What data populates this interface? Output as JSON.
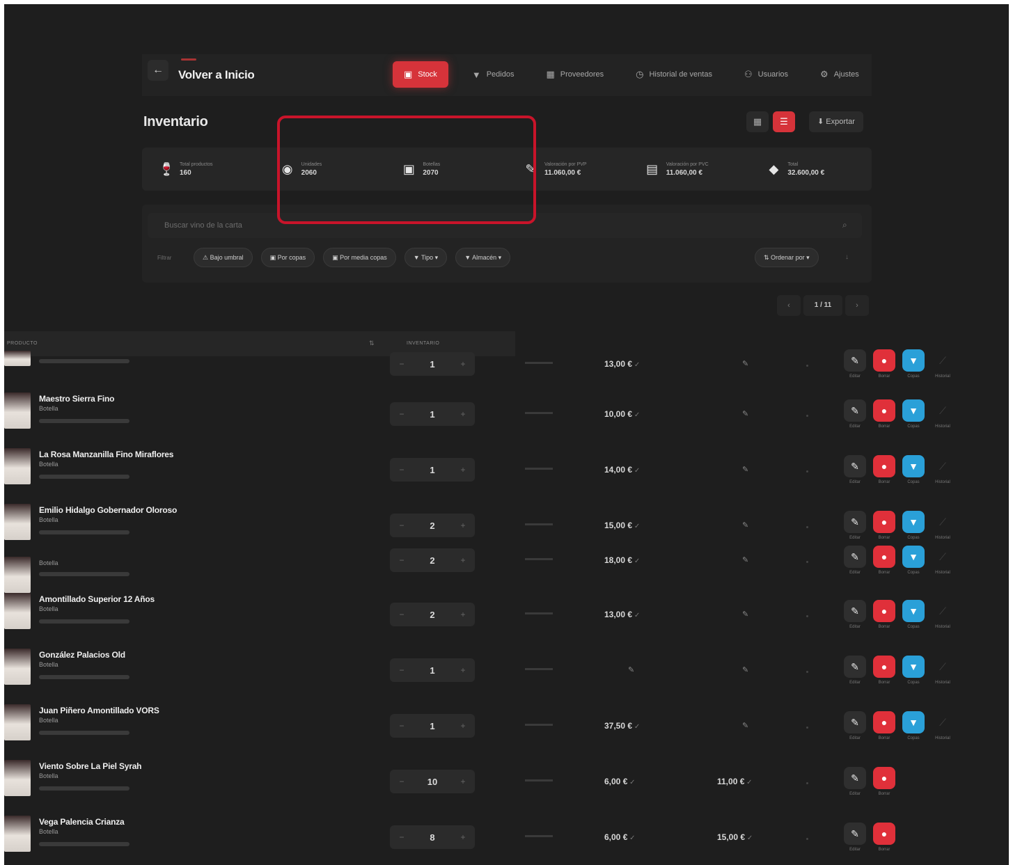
{
  "header": {
    "back_icon": "arrow-left-icon",
    "back_label": "Volver a Inicio"
  },
  "nav": [
    {
      "label": "Stock",
      "icon": "box-icon",
      "active": true
    },
    {
      "label": "Pedidos",
      "icon": "glass-icon"
    },
    {
      "label": "Proveedores",
      "icon": "building-icon"
    },
    {
      "label": "Historial de ventas",
      "icon": "clock-icon"
    },
    {
      "label": "Usuarios",
      "icon": "user-icon"
    },
    {
      "label": "Ajustes",
      "icon": "gear-icon"
    }
  ],
  "page": {
    "title": "Inventario",
    "export_label": "Exportar"
  },
  "stats": [
    {
      "label": "Total productos",
      "value": "160",
      "icon": "wine-glass-icon"
    },
    {
      "label": "Unidades",
      "value": "2060",
      "icon": "wine-bottle-icon"
    },
    {
      "label": "Botellas",
      "value": "2070",
      "icon": "calendar-icon"
    },
    {
      "label": "Valoración por PVP",
      "value": "11.060,00 €",
      "icon": "tag-icon"
    },
    {
      "label": "Valoración por PVC",
      "value": "11.060,00 €",
      "icon": "archive-icon"
    },
    {
      "label": "Total",
      "value": "32.600,00 €",
      "icon": "price-tag-icon"
    }
  ],
  "search": {
    "placeholder": "Buscar vino de la carta"
  },
  "filters": {
    "label": "Filtrar",
    "chips": [
      "Bajo umbral",
      "Por copas",
      "Por media copas",
      "Tipo",
      "Almacén"
    ],
    "sort_label": "Ordenar por"
  },
  "pagination": {
    "prev": "‹",
    "info": "1 / 11",
    "next": "›"
  },
  "table": {
    "col_product": "PRODUCTO",
    "col_stock": "INVENTARIO"
  },
  "rows": [
    {
      "name": "",
      "meta": "",
      "qty": "1",
      "price1": "13,00 €",
      "price2": "",
      "full_actions": true
    },
    {
      "name": "Maestro Sierra Fino",
      "meta": "Botella",
      "qty": "1",
      "price1": "10,00 €",
      "price2": "",
      "full_actions": true
    },
    {
      "name": "La Rosa Manzanilla Fino Miraflores",
      "meta": "Botella",
      "qty": "1",
      "price1": "14,00 €",
      "price2": "",
      "full_actions": true
    },
    {
      "name": "Emilio Hidalgo Gobernador Oloroso",
      "meta": "Botella",
      "qty": "2",
      "price1": "15,00 €",
      "price2": "",
      "full_actions": true
    },
    {
      "name": "",
      "meta": "Botella",
      "qty": "2",
      "price1": "18,00 €",
      "price2": "",
      "full_actions": true
    },
    {
      "name": "Amontillado Superior 12 Años",
      "meta": "Botella",
      "qty": "2",
      "price1": "13,00 €",
      "price2": "",
      "full_actions": true
    },
    {
      "name": "González Palacios Old",
      "meta": "Botella",
      "qty": "1",
      "price1": "",
      "price2": "",
      "full_actions": true
    },
    {
      "name": "Juan Piñero Amontillado VORS",
      "meta": "Botella",
      "qty": "1",
      "price1": "37,50 €",
      "price2": "",
      "full_actions": true
    },
    {
      "name": "Viento Sobre La Piel Syrah",
      "meta": "Botella",
      "qty": "10",
      "price1": "6,00 €",
      "price2": "11,00 €",
      "full_actions": false
    },
    {
      "name": "Vega Palencia Crianza",
      "meta": "Botella",
      "qty": "8",
      "price1": "6,00 €",
      "price2": "15,00 €",
      "full_actions": false
    }
  ],
  "actions": {
    "edit": "Editar",
    "delete": "Borrar",
    "info": "Copas",
    "more": "Historial"
  },
  "colors": {
    "accent": "#d6333a",
    "highlight": "#c8142a",
    "info": "#2aa0d8",
    "background": "#1e1e1e"
  }
}
